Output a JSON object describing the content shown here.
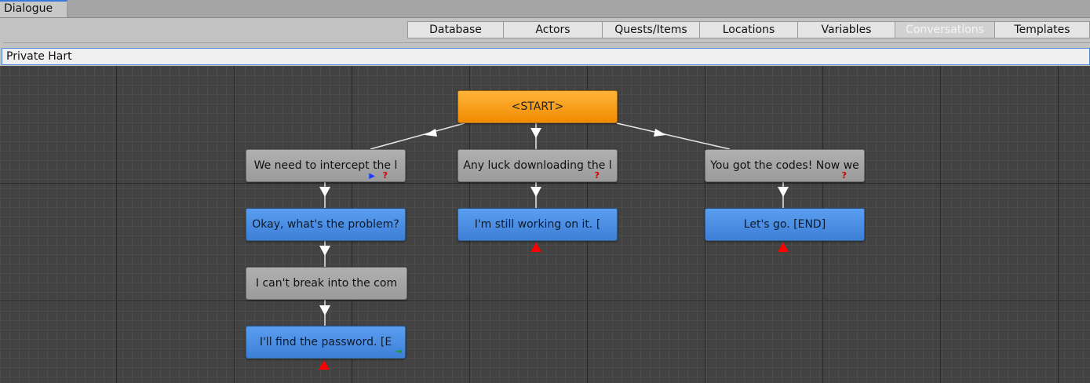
{
  "window": {
    "tab_title": "Dialogue"
  },
  "toolbar": {
    "tabs": [
      {
        "label": "Database",
        "active": false
      },
      {
        "label": "Actors",
        "active": false
      },
      {
        "label": "Quests/Items",
        "active": false
      },
      {
        "label": "Locations",
        "active": false
      },
      {
        "label": "Variables",
        "active": false
      },
      {
        "label": "Conversations",
        "active": true
      },
      {
        "label": "Templates",
        "active": false
      }
    ]
  },
  "conversation": {
    "title": "Private Hart"
  },
  "nodes": {
    "start": {
      "text": "<START>",
      "type": "start"
    },
    "npc_1": {
      "text": "We need to intercept the l",
      "type": "npc",
      "indicators": [
        "flag-icon",
        "question-icon"
      ]
    },
    "npc_2": {
      "text": "Any luck downloading the l",
      "type": "npc",
      "indicators": [
        "question-icon"
      ]
    },
    "npc_3": {
      "text": "You got the codes! Now we",
      "type": "npc",
      "indicators": [
        "question-icon"
      ]
    },
    "pc_1": {
      "text": "Okay, what's the problem?",
      "type": "pc"
    },
    "pc_2": {
      "text": "I'm still working on it. [",
      "type": "pc"
    },
    "pc_3": {
      "text": "Let's go. [END]",
      "type": "pc"
    },
    "npc_4": {
      "text": "I can't break into the com",
      "type": "npc"
    },
    "pc_4": {
      "text": "I'll find the password. [E",
      "type": "pc",
      "indicators": [
        "arrow-right-icon"
      ]
    }
  },
  "colors": {
    "npc_node": "#a5a5a5",
    "pc_node": "#4a8ee6",
    "start_node": "#f59a10",
    "end_marker": "#ff0000",
    "canvas": "#424242"
  }
}
